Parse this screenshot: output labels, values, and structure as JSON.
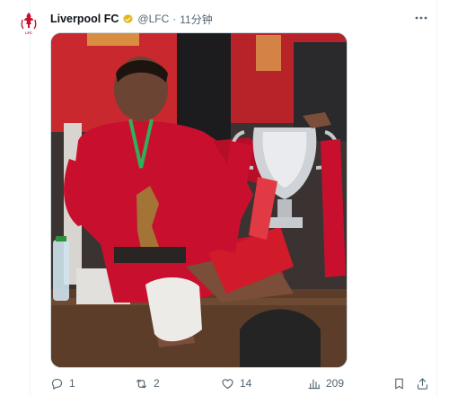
{
  "tweet": {
    "author_name": "Liverpool FC",
    "handle": "@LFC",
    "separator": "·",
    "time": "11分钟",
    "avatar_icon": "liverpool-crest-icon",
    "verified_icon": "gold-verified-badge-icon",
    "media_alt": "player-with-trophy-photo"
  },
  "actions": {
    "reply_count": "1",
    "retweet_count": "2",
    "like_count": "14",
    "views_count": "209"
  },
  "colors": {
    "text_primary": "#0f1419",
    "text_secondary": "#536471",
    "lfc_red": "#c8102e",
    "verified_gold": "#e2b719"
  }
}
